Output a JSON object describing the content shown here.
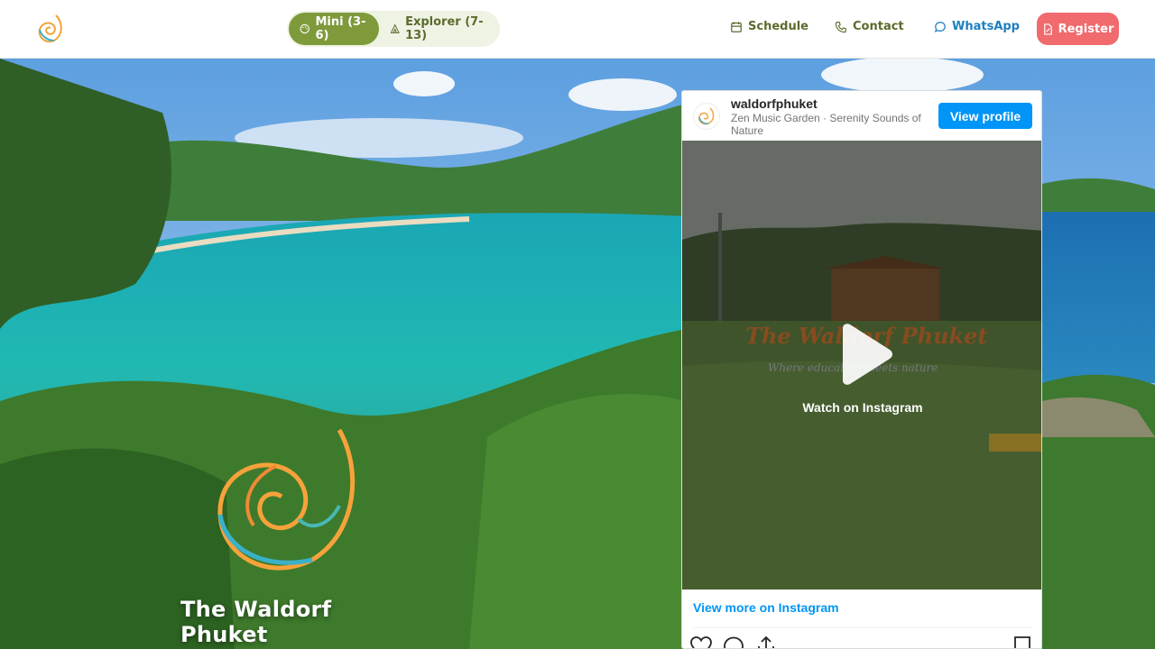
{
  "nav": {
    "programs": [
      {
        "label": "Mini (3-6)",
        "icon": "palette-icon",
        "active": true
      },
      {
        "label": "Explorer (7-13)",
        "icon": "tent-icon",
        "active": false
      }
    ],
    "schedule": "Schedule",
    "contact": "Contact",
    "whatsapp": "WhatsApp",
    "register": "Register"
  },
  "hero": {
    "title": "The Waldorf Phuket"
  },
  "instagram": {
    "username": "waldorfphuket",
    "subtitle": "Zen Music Garden · Serenity Sounds of Nature",
    "view_profile": "View profile",
    "watch_label": "Watch on Instagram",
    "view_more": "View more on Instagram",
    "video_watermark_title": "The Waldorf Phuket",
    "video_watermark_tagline": "Where education meets nature"
  },
  "colors": {
    "accent_green": "#7e9a3b",
    "register_red": "#f06a6e",
    "whatsapp_blue": "#1c7fc0",
    "instagram_blue": "#0095f6"
  }
}
